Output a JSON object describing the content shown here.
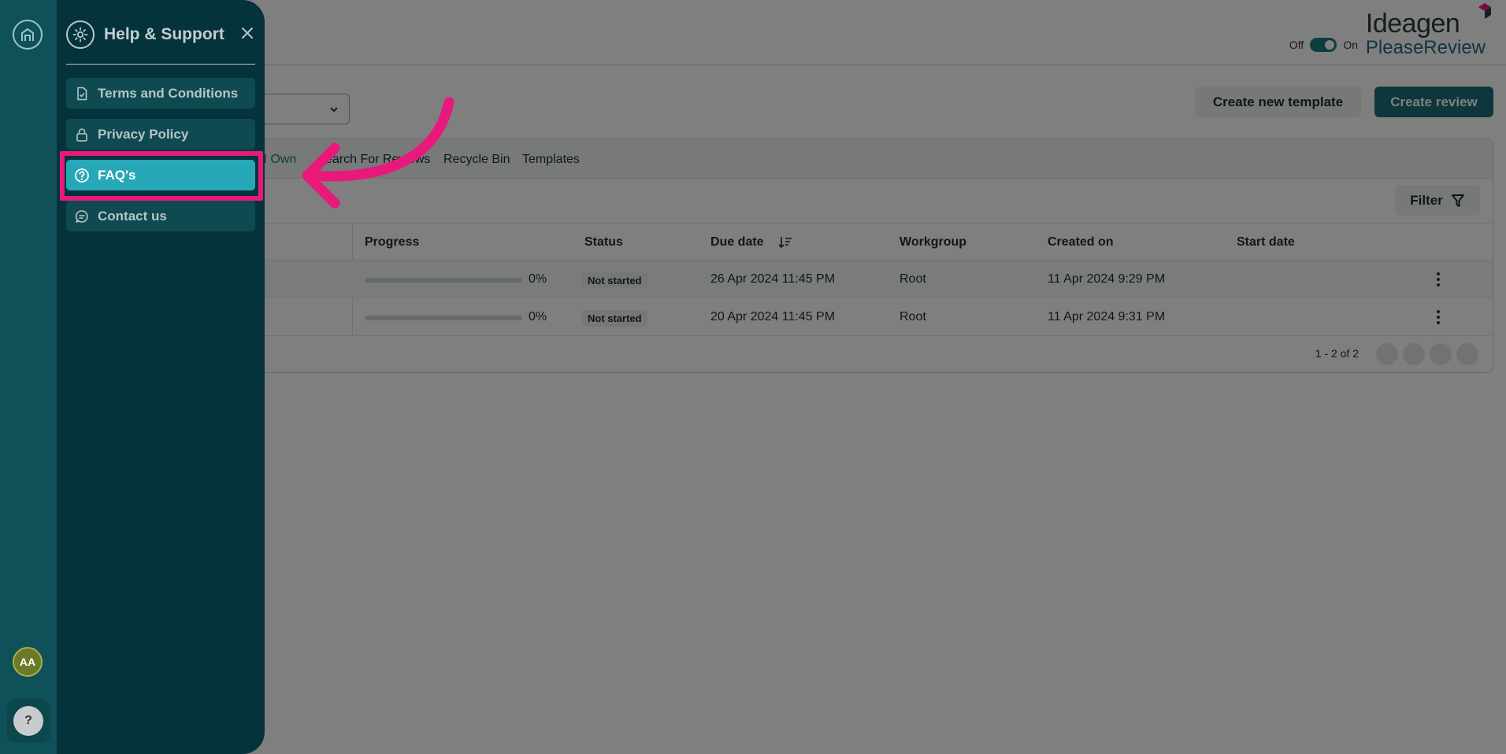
{
  "header": {
    "toggle_off": "Off",
    "toggle_on": "On",
    "brand_top": "Ideagen",
    "brand_bottom": "PleaseReview"
  },
  "toolbar": {
    "create_template_label": "Create new template",
    "create_review_label": "Create review"
  },
  "tabs": [
    {
      "label": "s I Own",
      "active": true
    },
    {
      "label": "earch For Reviews"
    },
    {
      "label": "Recycle Bin"
    },
    {
      "label": "Templates"
    }
  ],
  "filter": {
    "label": "Filter"
  },
  "table": {
    "columns": [
      "Progress",
      "Status",
      "Due date",
      "Workgroup",
      "Created on",
      "Start date"
    ],
    "rows": [
      {
        "progress": "0%",
        "status": "Not started",
        "due": "26 Apr 2024 11:45 PM",
        "workgroup": "Root",
        "created": "11 Apr 2024 9:29 PM",
        "start": ""
      },
      {
        "progress": "0%",
        "status": "Not started",
        "due": "20 Apr 2024 11:45 PM",
        "workgroup": "Root",
        "created": "11 Apr 2024 9:31 PM",
        "start": ""
      }
    ]
  },
  "pager": {
    "text": "1 - 2 of 2"
  },
  "rail": {
    "avatar": "AA",
    "help": "?"
  },
  "drawer": {
    "title": "Help & Support",
    "items": [
      {
        "label": "Terms and Conditions",
        "icon": "document-icon"
      },
      {
        "label": "Privacy Policy",
        "icon": "lock-icon"
      },
      {
        "label": "FAQ's",
        "icon": "question-circle-icon",
        "active": true
      },
      {
        "label": "Contact us",
        "icon": "chat-icon"
      }
    ]
  },
  "colors": {
    "accent": "#1a6f78",
    "drawer_bg": "#04333b",
    "active_item": "#26a8b6",
    "highlight": "#e8197b"
  }
}
